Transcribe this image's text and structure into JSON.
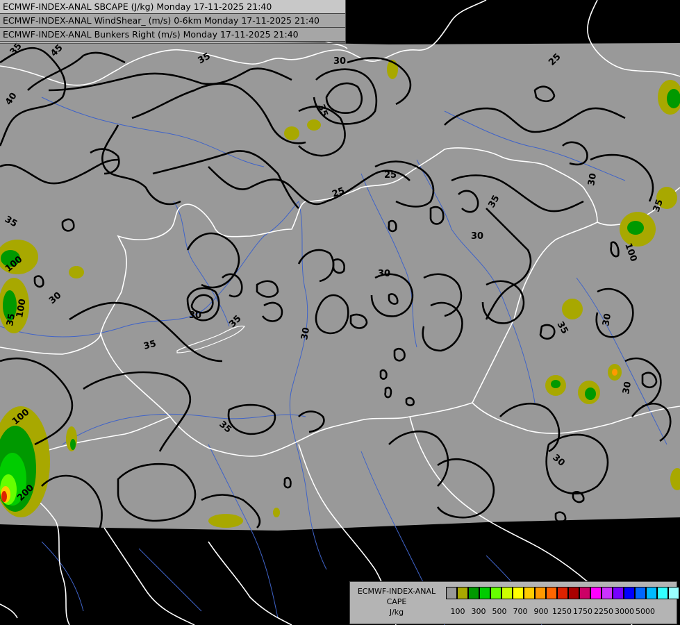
{
  "header": {
    "line1": "ECMWF-INDEX-ANAL SBCAPE (J/kg) Monday 17-11-2025 21:40",
    "line2": "ECMWF-INDEX-ANAL WindShear_ (m/s) 0-6km Monday 17-11-2025 21:40",
    "line3": "ECMWF-INDEX-ANAL Bunkers Right (m/s) Monday 17-11-2025 21:40"
  },
  "legend": {
    "title_line1": "ECMWF-INDEX-ANAL",
    "title_line2": "CAPE",
    "title_line3": "J/kg",
    "colors": [
      "#999999",
      "#a8a800",
      "#009900",
      "#00cc00",
      "#66ff00",
      "#ccff00",
      "#ffff00",
      "#ffcc00",
      "#ff9900",
      "#ff6600",
      "#dd2200",
      "#aa0000",
      "#cc0066",
      "#ff00ff",
      "#cc33ff",
      "#7700ff",
      "#0000ff",
      "#0066ff",
      "#00bbff",
      "#33ffff",
      "#99ffff",
      "#ffffff"
    ],
    "ticks": [
      "100",
      "300",
      "500",
      "700",
      "900",
      "1250",
      "1750",
      "2250",
      "3000",
      "5000"
    ]
  },
  "contour_labels": [
    "35",
    "45",
    "40",
    "35",
    "30",
    "25",
    "35",
    "25",
    "35",
    "25",
    "30",
    "35",
    "30",
    "35",
    "30",
    "30",
    "30",
    "35",
    "30",
    "35",
    "100",
    "100",
    "100",
    "200",
    "35",
    "100",
    "35",
    "30",
    "30",
    "35",
    "30"
  ],
  "map": {
    "background_color": "#999999",
    "outside_color": "#000000",
    "border_color": "#ffffff",
    "river_color": "#3f63c8",
    "contour_color": "#000000"
  }
}
